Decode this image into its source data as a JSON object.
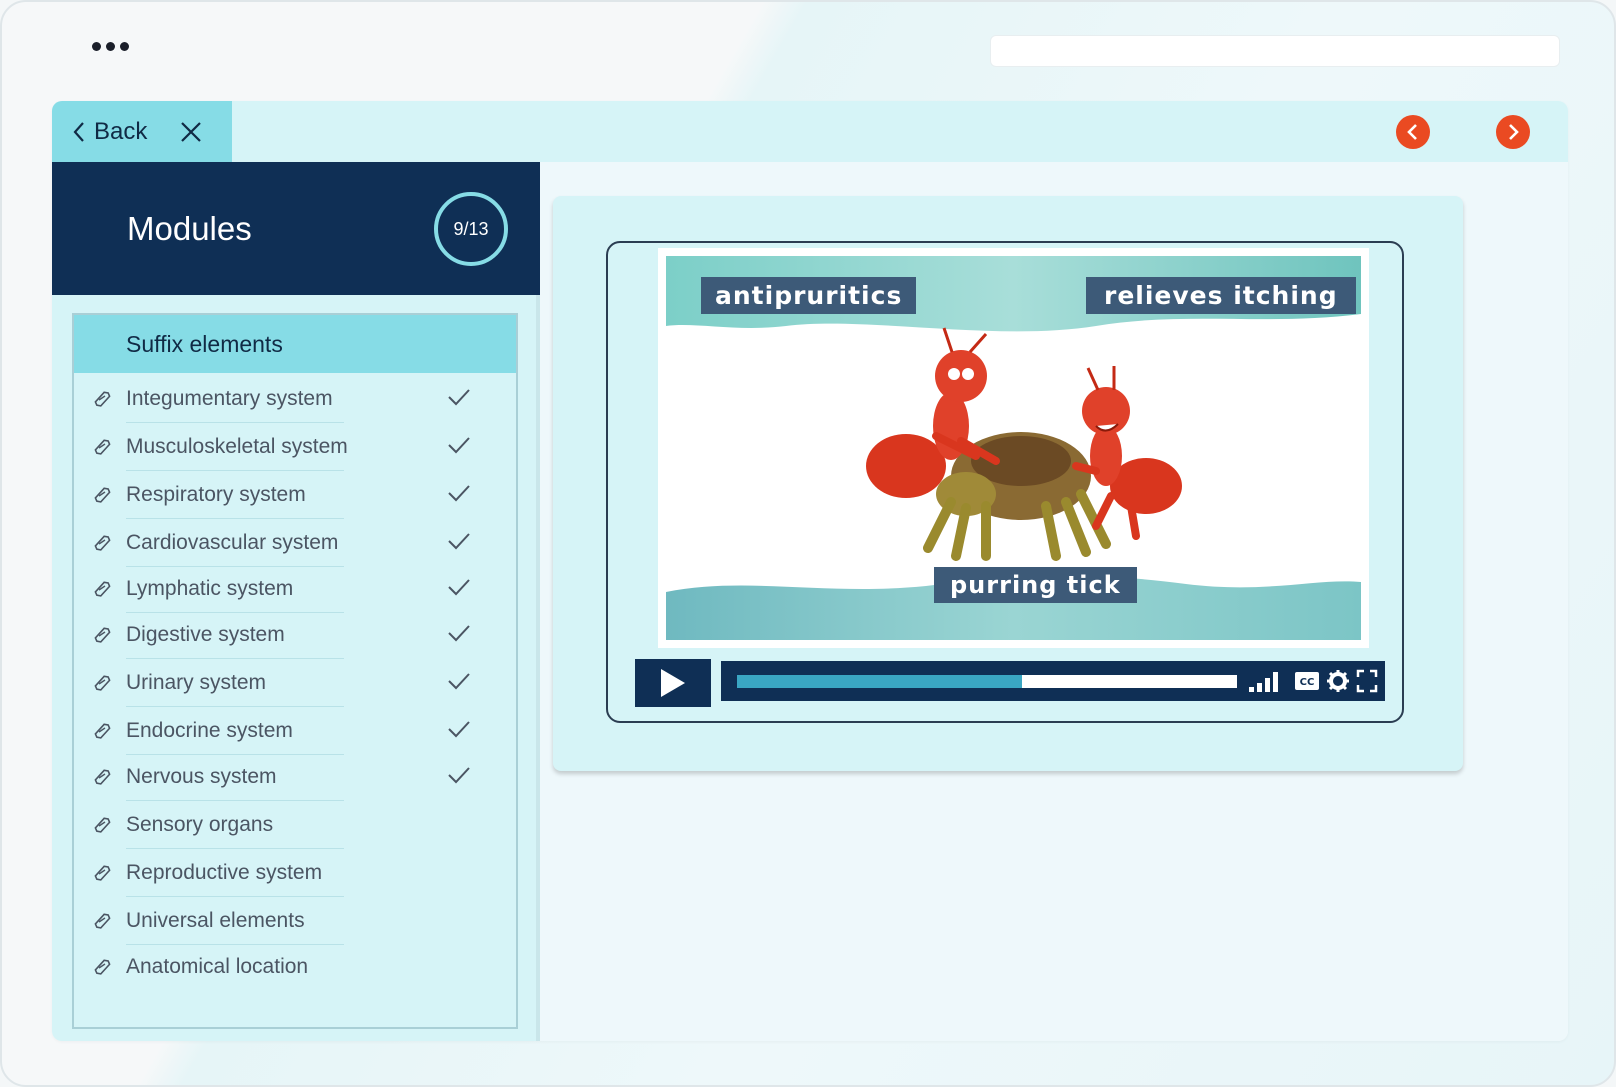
{
  "header": {
    "back_label": "Back"
  },
  "sidebar": {
    "title": "Modules",
    "progress": "9/13",
    "section_title": "Suffix elements",
    "items": [
      {
        "label": "Integumentary system",
        "completed": true
      },
      {
        "label": "Musculoskeletal system",
        "completed": true
      },
      {
        "label": "Respiratory system",
        "completed": true
      },
      {
        "label": "Cardiovascular system",
        "completed": true
      },
      {
        "label": "Lymphatic system",
        "completed": true
      },
      {
        "label": "Digestive system",
        "completed": true
      },
      {
        "label": "Urinary system",
        "completed": true
      },
      {
        "label": "Endocrine system",
        "completed": true
      },
      {
        "label": "Nervous system",
        "completed": true
      },
      {
        "label": "Sensory organs",
        "completed": false
      },
      {
        "label": "Reproductive system",
        "completed": false
      },
      {
        "label": "Universal elements",
        "completed": false
      },
      {
        "label": "Anatomical location",
        "completed": false
      }
    ]
  },
  "video": {
    "caption_left": "antipruritics",
    "caption_right": "relieves itching",
    "caption_bottom": "purring tick",
    "progress_fraction": 0.57
  },
  "colors": {
    "navy": "#0f2f55",
    "aqua": "#86dce6",
    "accent_orange": "#ea4a22",
    "progress_blue": "#3aa6c3"
  },
  "icons": {
    "back": "chevron-left-icon",
    "close": "close-icon",
    "prev": "chevron-left-icon",
    "next": "chevron-right-icon",
    "item": "link-icon",
    "done": "checkmark-icon",
    "play": "play-icon",
    "volume": "volume-bars-icon",
    "captions": "cc-icon",
    "settings": "gear-icon",
    "fullscreen": "fullscreen-icon"
  }
}
